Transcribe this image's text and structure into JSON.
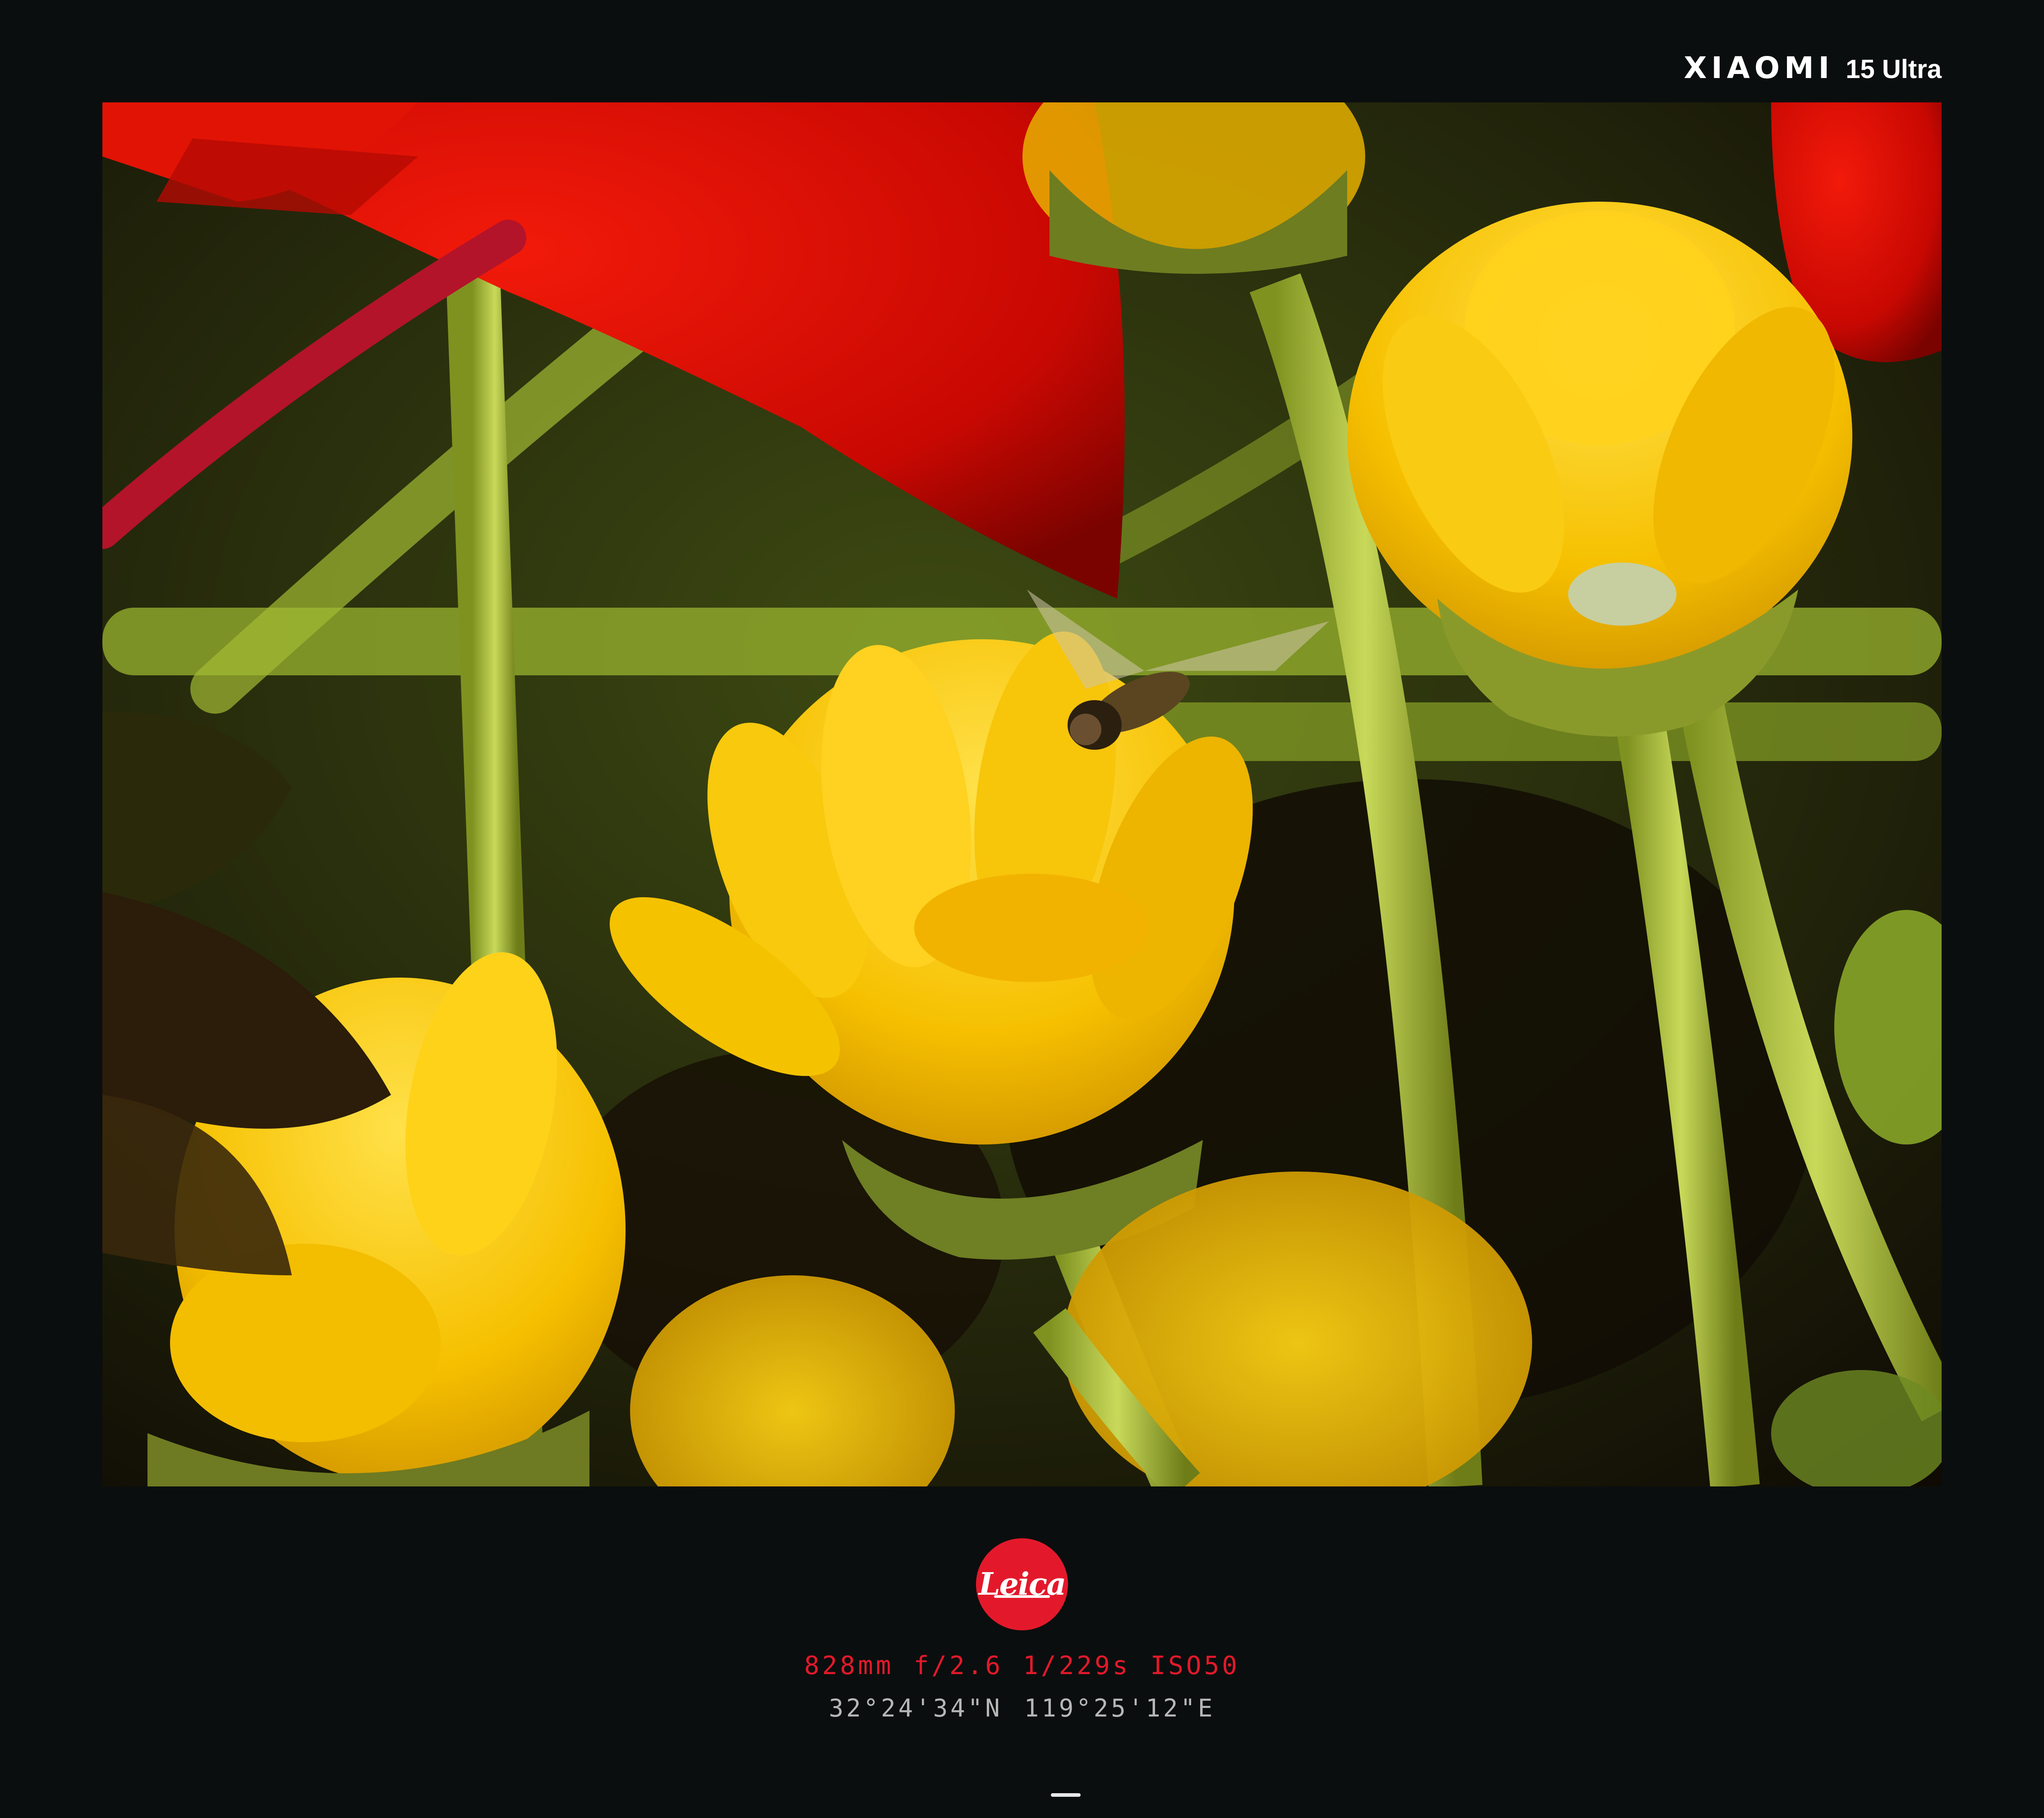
{
  "brand": {
    "name": "XIAOMI",
    "model": "15 Ultra"
  },
  "photo": {
    "subject": "flower-photo",
    "colors": {
      "yellow": "#f5c400",
      "red": "#d60a05",
      "green": "#a9c23a",
      "dark": "#140e05"
    }
  },
  "logo": {
    "text": "Leica",
    "color": "#e3192b"
  },
  "exif": {
    "focal_length": "828mm",
    "aperture": "f/2.6",
    "shutter": "1/229s",
    "iso": "ISO50"
  },
  "location": {
    "latitude": "32°24'34\"N",
    "longitude": "119°25'12\"E"
  }
}
